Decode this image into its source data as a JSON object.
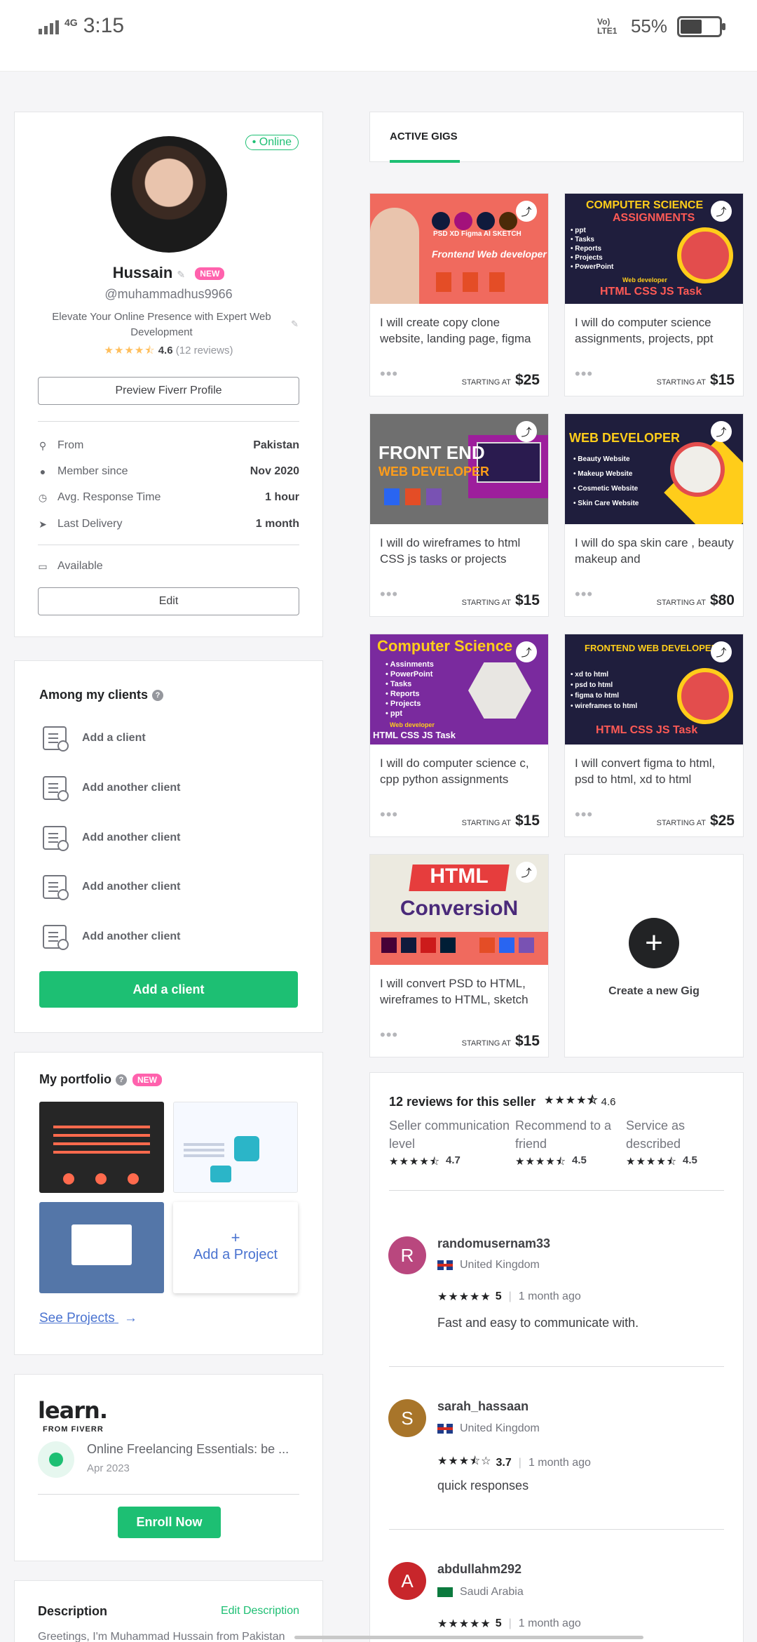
{
  "status": {
    "network": "4G",
    "time": "3:15",
    "volte": "Vo) LTE1",
    "battery": "55%",
    "battery_level": 0.55
  },
  "profile": {
    "online": "• Online",
    "name": "Hussain",
    "new_badge": "NEW",
    "username": "@muhammadhus9966",
    "tagline": "Elevate Your Online Presence with Expert Web Development",
    "rating": "4.6",
    "reviews": "(12 reviews)",
    "preview_button": "Preview Fiverr Profile",
    "info": [
      {
        "label": "From",
        "value": "Pakistan",
        "icon": "location-pin-icon"
      },
      {
        "label": "Member since",
        "value": "Nov 2020",
        "icon": "user-icon"
      },
      {
        "label": "Avg. Response Time",
        "value": "1 hour",
        "icon": "clock-icon"
      },
      {
        "label": "Last Delivery",
        "value": "1 month",
        "icon": "paper-plane-icon"
      }
    ],
    "availability": "Available",
    "edit_button": "Edit"
  },
  "clients": {
    "title": "Among my clients",
    "items": [
      "Add a client",
      "Add another client",
      "Add another client",
      "Add another client",
      "Add another client"
    ],
    "add_button": "Add a client"
  },
  "portfolio": {
    "title": "My portfolio",
    "new_badge": "NEW",
    "add_project": "Add a Project",
    "add_symbol": "+",
    "see_projects": "See Projects",
    "arrow": "→"
  },
  "learn": {
    "logo": "learn.",
    "logo_sub": "FROM FIVERR",
    "course": "Online Freelancing Essentials: be ...",
    "date": "Apr 2023",
    "enroll_button": "Enroll Now"
  },
  "description": {
    "title": "Description",
    "edit_link": "Edit Description",
    "text": "Greetings, I'm Muhammad Hussain from Pakistan"
  },
  "gigs_tab": "ACTIVE GIGS",
  "gigs": [
    {
      "title": "I will create copy clone website, landing page, figma",
      "starting_at": "STARTING AT",
      "price": "$25",
      "thumb_text": "Frontend Web developer",
      "thumb_sub": "PSD  XD  Figma  AI  SKETCH"
    },
    {
      "title": "I will do computer science assignments, projects, ppt",
      "starting_at": "STARTING AT",
      "price": "$15",
      "thumb_text": "COMPUTER SCIENCE",
      "thumb_sub": "ASSIGNMENTS",
      "thumb_list": [
        "• ppt",
        "• Tasks",
        "• Reports",
        "• Projects",
        "• PowerPoint"
      ],
      "thumb_footer": "HTML CSS JS Task",
      "thumb_role": "Web developer"
    },
    {
      "title": "I will do wireframes to html CSS js tasks or projects",
      "starting_at": "STARTING AT",
      "price": "$15",
      "thumb_text": "FRONT END",
      "thumb_sub": "WEB DEVELOPER"
    },
    {
      "title": "I will do spa skin care , beauty makeup and",
      "starting_at": "STARTING AT",
      "price": "$80",
      "thumb_text": "WEB DEVELOPER",
      "thumb_list": [
        "• Beauty Website",
        "• Makeup Website",
        "• Cosmetic Website",
        "• Skin Care Website"
      ]
    },
    {
      "title": "I will do computer science c, cpp python assignments",
      "starting_at": "STARTING AT",
      "price": "$15",
      "thumb_text": "Computer Science",
      "thumb_list": [
        "• Assinments",
        "• PowerPoint",
        "• Tasks",
        "• Reports",
        "• Projects",
        "• ppt"
      ],
      "thumb_footer": "HTML CSS JS Task",
      "thumb_role": "Web developer"
    },
    {
      "title": "I will convert figma to html, psd to html, xd to html",
      "starting_at": "STARTING AT",
      "price": "$25",
      "thumb_text": "FRONTEND WEB DEVELOPER",
      "thumb_list": [
        "• xd to html",
        "• psd to html",
        "• figma to html",
        "• wireframes to html"
      ],
      "thumb_footer": "HTML CSS JS Task"
    },
    {
      "title": "I will convert PSD to HTML, wireframes to HTML, sketch",
      "starting_at": "STARTING AT",
      "price": "$15",
      "thumb_text": "HTML",
      "thumb_sub": "ConversioN"
    }
  ],
  "create_gig": {
    "symbol": "+",
    "label": "Create a new Gig"
  },
  "reviews_summary": {
    "title": "12 reviews for this seller",
    "rating": "4.6",
    "breakdown": [
      {
        "label": "Seller communication level",
        "value": "4.7"
      },
      {
        "label": "Recommend to a friend",
        "value": "4.5"
      },
      {
        "label": "Service as described",
        "value": "4.5"
      }
    ]
  },
  "reviews": [
    {
      "initial": "R",
      "name": "randomusernam33",
      "country": "United Kingdom",
      "rating": "5",
      "ago": "1 month ago",
      "text": "Fast and easy to communicate with.",
      "color": "#b9477e"
    },
    {
      "initial": "S",
      "name": "sarah_hassaan",
      "country": "United Kingdom",
      "rating": "3.7",
      "ago": "1 month ago",
      "text": "quick responses",
      "color": "#a8752a"
    },
    {
      "initial": "A",
      "name": "abdullahm292",
      "country": "Saudi Arabia",
      "rating": "5",
      "ago": "1 month ago",
      "text": "",
      "color": "#c8262b"
    }
  ],
  "colors": {
    "accent": "#1dbf73",
    "new_badge": "#ff62ad",
    "star": "#ffbe5b"
  }
}
